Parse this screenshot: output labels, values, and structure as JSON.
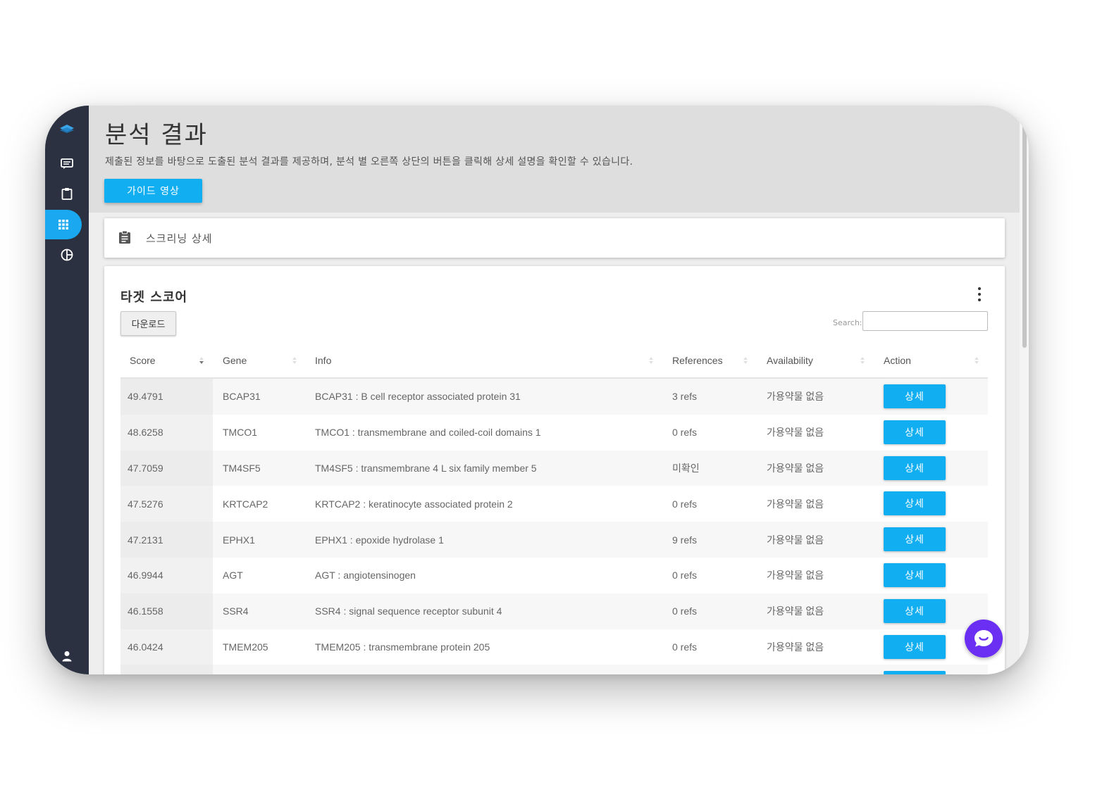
{
  "sidebar": {
    "icons": [
      "logo-icon",
      "message-icon",
      "clipboard-icon",
      "grid-icon",
      "pie-chart-icon",
      "user-icon"
    ],
    "active_item": "grid-icon"
  },
  "header": {
    "title": "분석 결과",
    "description": "제출된 정보를 바탕으로 도출된 분석 결과를 제공하며, 분석 별 오른쪽 상단의 버튼을 클릭해 상세 설명을 확인할 수 있습니다.",
    "guide_button": "가이드 영상"
  },
  "screening": {
    "label": "스크리닝 상세"
  },
  "target_card": {
    "title": "타겟 스코어",
    "download_button": "다운로드",
    "search_label": "Search:",
    "search_value": "",
    "columns": [
      "Score",
      "Gene",
      "Info",
      "References",
      "Availability",
      "Action"
    ],
    "rows": [
      {
        "score": "49.4791",
        "gene": "BCAP31",
        "info": "BCAP31 : B cell receptor associated protein 31",
        "refs": "3 refs",
        "availability": "가용약물 없음",
        "action": "상세"
      },
      {
        "score": "48.6258",
        "gene": "TMCO1",
        "info": "TMCO1 : transmembrane and coiled-coil domains 1",
        "refs": "0 refs",
        "availability": "가용약물 없음",
        "action": "상세"
      },
      {
        "score": "47.7059",
        "gene": "TM4SF5",
        "info": "TM4SF5 : transmembrane 4 L six family member 5",
        "refs": "미확인",
        "availability": "가용약물 없음",
        "action": "상세"
      },
      {
        "score": "47.5276",
        "gene": "KRTCAP2",
        "info": "KRTCAP2 : keratinocyte associated protein 2",
        "refs": "0 refs",
        "availability": "가용약물 없음",
        "action": "상세"
      },
      {
        "score": "47.2131",
        "gene": "EPHX1",
        "info": "EPHX1 : epoxide hydrolase 1",
        "refs": "9 refs",
        "availability": "가용약물 없음",
        "action": "상세"
      },
      {
        "score": "46.9944",
        "gene": "AGT",
        "info": "AGT : angiotensinogen",
        "refs": "0 refs",
        "availability": "가용약물 없음",
        "action": "상세"
      },
      {
        "score": "46.1558",
        "gene": "SSR4",
        "info": "SSR4 : signal sequence receptor subunit 4",
        "refs": "0 refs",
        "availability": "가용약물 없음",
        "action": "상세"
      },
      {
        "score": "46.0424",
        "gene": "TMEM205",
        "info": "TMEM205 : transmembrane protein 205",
        "refs": "0 refs",
        "availability": "가용약물 없음",
        "action": "상세"
      }
    ]
  },
  "colors": {
    "sidebar": "#2b3140",
    "accent": "#12aef2",
    "chat": "#6a2ff2"
  }
}
